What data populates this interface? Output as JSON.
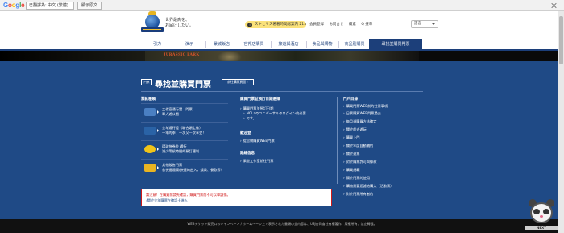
{
  "translate_bar": {
    "logo": "Google",
    "language": "已翻譯為: 中文 (繁體)",
    "show_original": "顯示原文",
    "options": ""
  },
  "header": {
    "slogan_line1": "世界最高を、",
    "slogan_line2": "お届けしたい。",
    "notice": "ストとリス著著時間総案内 21:00",
    "links": [
      "会員登録",
      "お問合せ",
      "検索",
      "Q 搜尋"
    ],
    "language_select": "語言"
  },
  "nav": {
    "items": [
      "引力",
      "演示",
      "景城飯店",
      "官邦店購買",
      "旅遊與酒店",
      "食品與購物",
      "商品別購買",
      "尋找並購買門票"
    ]
  },
  "banner": {
    "logo_text": "JURASSIC PARK"
  },
  "main": {
    "badge": "門票",
    "title": "尋找並購買門票",
    "title_button": "前往購票頁面 ›",
    "col1_head": "票款種類",
    "col2_head": "購買門票並預訂日期選擇",
    "col3_head": "門戶目錄",
    "tickets": [
      {
        "line1": "工作室通行證（門票）",
        "line2": "單人遊公園",
        "icon_color": "#4a7fc2"
      },
      {
        "line1": "全年通行證（聯合類定做）",
        "line2": "一年的季、一次又一次享受！",
        "icon_color": "#2a63a6"
      },
      {
        "line1": "環球快券® 通行",
        "line2": "減少等候時間的預訂權利",
        "icon_color": "#f0c419"
      },
      {
        "line1": "其他販售門票",
        "line2": "各快速通關/快速的出入，娛樂、餐飲等！",
        "icon_color": "#e8b422"
      }
    ],
    "middle": {
      "sec1": [
        "購買門票並預訂日期",
        "NOLaのユニバーサルのログイン的必要",
        "です。"
      ],
      "sec2_head": "歡迎登",
      "sec2_item": "從官網購買WEB門票",
      "sec3_head": "路線信息",
      "sec3_item": "乘坐工作室前往門票"
    },
    "right": [
      "購買門票WEB前的注意事項",
      "日票購買WEB門票過去",
      "每月週購買方法確定",
      "關於前去遊玩",
      "購買上門",
      "關於年度自動續約",
      "關於退票",
      "對於購票許可與條款",
      "購買規範",
      "關於門票的使用",
      "購物需要過濾結購入（活動票）",
      "對於門票所有者的"
    ],
    "warning": {
      "line1": "請注意！在購買前請先確認，購買門票前不可以單調換。",
      "line2": "›關於全年購票在確認卡進入"
    }
  },
  "footer": {
    "text": "WEBチケット販売口のキャンペーン / ホームページ上で表示された書類の全内容は、USJ合同會社有權著作。版權所有、禁止轉載。"
  },
  "watermark": {
    "text": "NEXT"
  }
}
